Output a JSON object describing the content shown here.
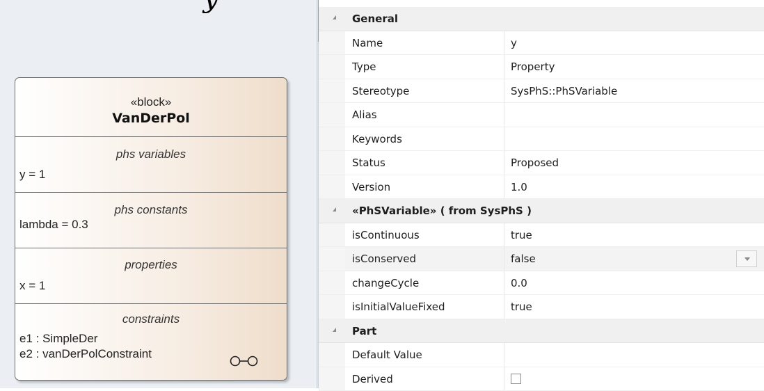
{
  "diagram": {
    "top_glyph": "y",
    "block": {
      "stereotype": "«block»",
      "name": "VanDerPol",
      "compartments": [
        {
          "title": "phs variables",
          "lines": [
            "y = 1"
          ]
        },
        {
          "title": "phs constants",
          "lines": [
            "lambda = 0.3"
          ]
        },
        {
          "title": "properties",
          "lines": [
            "x = 1"
          ]
        },
        {
          "title": "constraints",
          "lines": [
            "e1 : SimpleDer",
            "e2 : vanDerPolConstraint"
          ]
        }
      ],
      "constraint_icon": "glasses-icon"
    }
  },
  "properties": {
    "general": {
      "label": "General",
      "rows": [
        {
          "name": "Name",
          "value": "y"
        },
        {
          "name": "Type",
          "value": "Property"
        },
        {
          "name": "Stereotype",
          "value": "SysPhS::PhSVariable"
        },
        {
          "name": "Alias",
          "value": ""
        },
        {
          "name": "Keywords",
          "value": ""
        },
        {
          "name": "Status",
          "value": "Proposed"
        },
        {
          "name": "Version",
          "value": "1.0"
        }
      ]
    },
    "phsvariable": {
      "label": "«PhSVariable»  ( from SysPhS )",
      "rows": [
        {
          "name": "isContinuous",
          "value": "true"
        },
        {
          "name": "isConserved",
          "value": "false"
        },
        {
          "name": "changeCycle",
          "value": "0.0"
        },
        {
          "name": "isInitialValueFixed",
          "value": "true"
        }
      ]
    },
    "part": {
      "label": "Part",
      "rows": [
        {
          "name": "Default Value",
          "value": ""
        },
        {
          "name": "Derived",
          "value": ""
        }
      ],
      "derived_checked": false
    }
  },
  "colors": {
    "canvas_bg": "#ebeef2",
    "block_border": "#6c6c6c",
    "block_fill_end": "#efddcb",
    "category_bg": "#f0f0f0",
    "selected_row_bg": "#f3f3f3"
  }
}
